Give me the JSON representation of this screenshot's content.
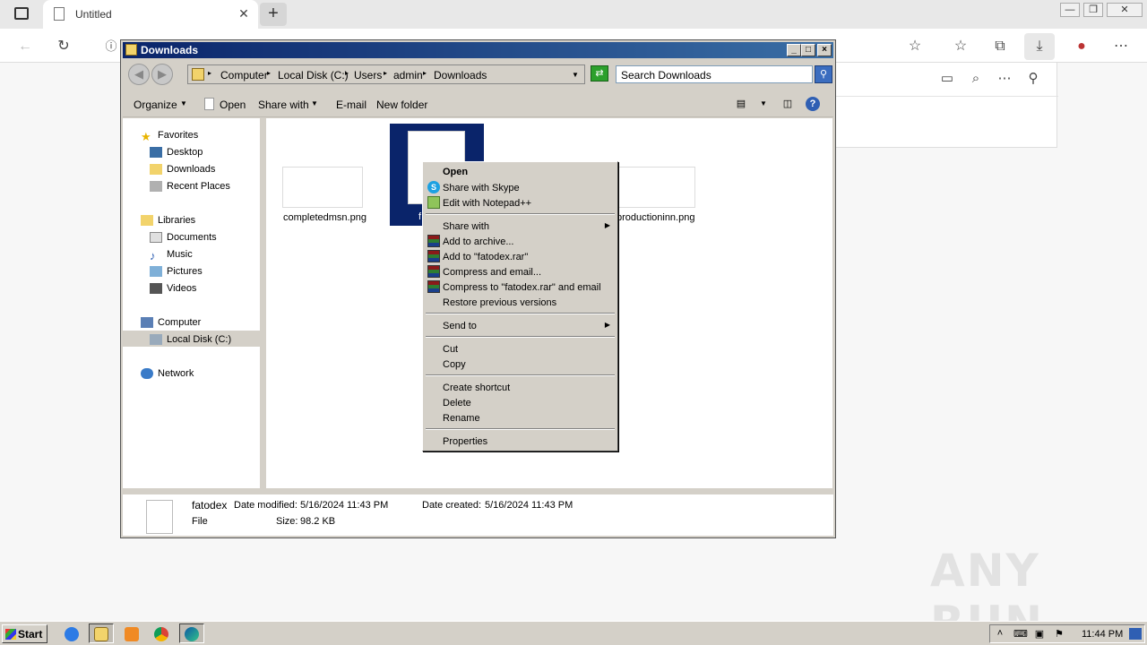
{
  "browser": {
    "tab_title": "Untitled",
    "tab_close": "✕",
    "new_tab": "+",
    "window_controls": [
      "—",
      "❐",
      "✕"
    ],
    "toolbar_icons": [
      "back-arrow-icon",
      "refresh-icon",
      "info-icon",
      "favorite-add-icon",
      "favorites-icon",
      "collections-icon",
      "download-icon",
      "profile-icon",
      "more-icon"
    ],
    "downloads_panel_icons": [
      "folder-icon",
      "search-icon",
      "more-icon",
      "pin-icon"
    ]
  },
  "explorer": {
    "title": "Downloads",
    "caption_buttons": [
      "_",
      "□",
      "×"
    ],
    "breadcrumb": [
      "Computer",
      "Local Disk (C:)",
      "Users",
      "admin",
      "Downloads"
    ],
    "search_placeholder": "Search Downloads",
    "commands": {
      "organize": "Organize",
      "open": "Open",
      "share_with": "Share with",
      "email": "E-mail",
      "new_folder": "New folder"
    },
    "nav": {
      "favorites": "Favorites",
      "desktop": "Desktop",
      "downloads": "Downloads",
      "recent_places": "Recent Places",
      "libraries": "Libraries",
      "documents": "Documents",
      "music": "Music",
      "pictures": "Pictures",
      "videos": "Videos",
      "computer": "Computer",
      "local_disk": "Local Disk (C:)",
      "network": "Network"
    },
    "files": [
      {
        "name": "completedmsn.png"
      },
      {
        "name": "f"
      },
      {
        "name": "productioninn.png"
      }
    ],
    "details": {
      "name": "fatodex",
      "date_modified_label": "Date modified:",
      "date_modified": "5/16/2024 11:43 PM",
      "date_created_label": "Date created:",
      "date_created": "5/16/2024 11:43 PM",
      "type": "File",
      "size_label": "Size:",
      "size": "98.2 KB"
    }
  },
  "context_menu": {
    "open": "Open",
    "share_skype": "Share with Skype",
    "edit_notepad": "Edit with Notepad++",
    "share_with": "Share with",
    "add_archive": "Add to archive...",
    "add_rar": "Add to \"fatodex.rar\"",
    "compress_email": "Compress and email...",
    "compress_rar_email": "Compress to \"fatodex.rar\" and email",
    "restore": "Restore previous versions",
    "send_to": "Send to",
    "cut": "Cut",
    "copy": "Copy",
    "create_shortcut": "Create shortcut",
    "delete": "Delete",
    "rename": "Rename",
    "properties": "Properties"
  },
  "taskbar": {
    "start": "Start",
    "clock": "11:44 PM"
  },
  "watermark": "ANY RUN"
}
